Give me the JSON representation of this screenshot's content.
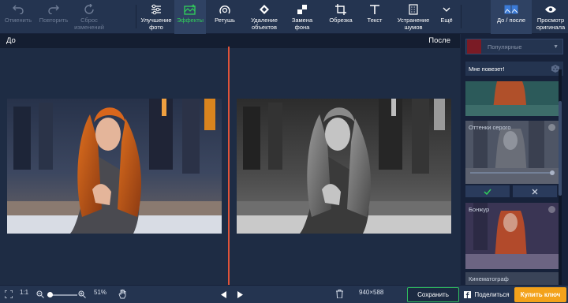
{
  "toolbar": {
    "undo": "Отменить",
    "redo": "Повторить",
    "reset": "Сброс\nизменений",
    "enhance": "Улучшение\nфото",
    "effects": "Эффекты",
    "retouch": "Ретушь",
    "remove_objects": "Удаление\nобъектов",
    "replace_bg": "Замена\nфона",
    "crop": "Обрезка",
    "text": "Текст",
    "denoise": "Устранение\nшумов",
    "more": "Ещё",
    "before_after": "До / после",
    "view_original": "Просмотр\nоригинала"
  },
  "viewer": {
    "before_label": "До",
    "after_label": "После"
  },
  "panel": {
    "category": "Популярные",
    "lucky": "Мне повезет!",
    "effects": [
      {
        "name": ""
      },
      {
        "name": "Оттенки серого"
      },
      {
        "name": "Бонжур"
      },
      {
        "name": "Кинематограф"
      }
    ]
  },
  "bottombar": {
    "zoom_fit": "1:1",
    "zoom_level": "51%",
    "dimensions": "940×588",
    "save": "Сохранить",
    "share": "Поделиться",
    "buy": "Купить ключ"
  },
  "colors": {
    "accent_green": "#30d05a",
    "divider_red": "#e0533a",
    "buy_orange": "#f3a21b"
  }
}
